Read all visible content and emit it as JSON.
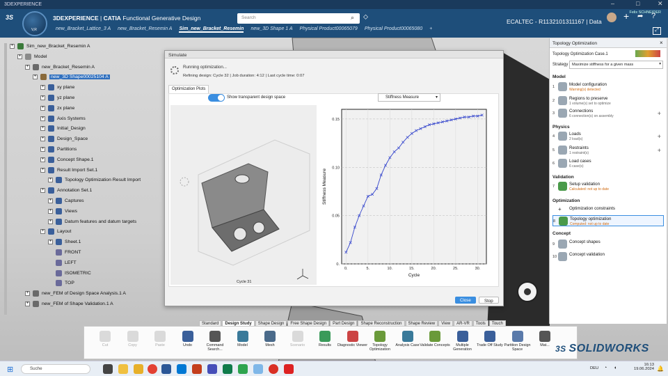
{
  "titlebar": {
    "title": "3DEXPERIENCE"
  },
  "header": {
    "brand_bold": "3DEXPERIENCE",
    "brand_sep": " | ",
    "brand_catia": "CATIA",
    "brand_app": "Functional Generative Design",
    "compass_label": "V,R",
    "search_placeholder": "Search",
    "user_name": "Felix SCHNEIDER",
    "project": "ECALTEC - R1132101311167 | Data",
    "tabs": [
      "new_Bracket_Lattice_3 A",
      "new_Bracket_Resemin A",
      "Sim_new_Bracket_Resemin",
      "new_3D Shape 1 A",
      "Physical Product00065079",
      "Physical Product00065080"
    ],
    "active_tab_index": 2
  },
  "tree": {
    "nodes": [
      {
        "label": "Sim_new_Bracket_Resemin A",
        "depth": 0
      },
      {
        "label": "Model",
        "depth": 1
      },
      {
        "label": "new_Bracket_Resemin A",
        "depth": 2
      },
      {
        "label": "new_3D Shape00025104 A",
        "depth": 3,
        "selected": true
      },
      {
        "label": "xy plane",
        "depth": 4
      },
      {
        "label": "yz plane",
        "depth": 4
      },
      {
        "label": "zx plane",
        "depth": 4
      },
      {
        "label": "Axis Systems",
        "depth": 4
      },
      {
        "label": "Initial_Design",
        "depth": 4
      },
      {
        "label": "Design_Space",
        "depth": 4
      },
      {
        "label": "Partitions",
        "depth": 4
      },
      {
        "label": "Concept Shape.1",
        "depth": 4
      },
      {
        "label": "Result Import Set.1",
        "depth": 4
      },
      {
        "label": "Topology Optimization Result Import",
        "depth": 5
      },
      {
        "label": "Annotation Set.1",
        "depth": 4
      },
      {
        "label": "Captures",
        "depth": 5
      },
      {
        "label": "Views",
        "depth": 5
      },
      {
        "label": "Datum features and datum targets",
        "depth": 5
      },
      {
        "label": "Layout",
        "depth": 4
      },
      {
        "label": "Sheet.1",
        "depth": 5
      },
      {
        "label": "FRONT",
        "depth": 6
      },
      {
        "label": "LEFT",
        "depth": 6
      },
      {
        "label": "ISOMETRIC",
        "depth": 6
      },
      {
        "label": "TOP",
        "depth": 6
      },
      {
        "label": "new_FEM of Design Space Analysis.1 A",
        "depth": 2
      },
      {
        "label": "new_FEM of Shape Validation.1 A",
        "depth": 2
      }
    ]
  },
  "dialog": {
    "title": "Simulate",
    "status": "Running optimization...",
    "details": "Refining design: Cycle 32   |   Job duration: 4:12   |   Last cycle time: 0:07",
    "tab": "Optimization Plots",
    "toggle_label": "Show transparent design space",
    "select_value": "Stiffness Measure",
    "cycle_caption": "Cycle 31",
    "close_label": "Close",
    "stop_label": "Stop"
  },
  "chart_data": {
    "type": "line",
    "xlabel": "Cycle",
    "ylabel": "Stiffness Measure",
    "xlim": [
      -1,
      32
    ],
    "ylim": [
      0,
      0.16
    ],
    "xticks": [
      "0.",
      "5.",
      "10.",
      "15.",
      "20.",
      "25.",
      "30."
    ],
    "yticks": [
      "0.",
      "0.05",
      "0.10",
      "0.15"
    ],
    "series": [
      {
        "x": [
          0,
          1,
          2,
          3,
          4,
          5,
          6,
          7,
          8,
          9,
          10,
          11,
          12,
          13,
          14,
          15,
          16,
          17,
          18,
          19,
          20,
          21,
          22,
          23,
          24,
          25,
          26,
          27,
          28,
          29,
          30,
          31
        ],
        "y": [
          0.012,
          0.022,
          0.038,
          0.05,
          0.06,
          0.07,
          0.072,
          0.078,
          0.092,
          0.102,
          0.11,
          0.116,
          0.12,
          0.126,
          0.131,
          0.135,
          0.138,
          0.14,
          0.142,
          0.144,
          0.145,
          0.146,
          0.147,
          0.148,
          0.149,
          0.15,
          0.151,
          0.152,
          0.152,
          0.153,
          0.153,
          0.154
        ]
      }
    ]
  },
  "rpanel": {
    "title": "Topology Optimization",
    "case": "Topology Optimization Case.1",
    "strategy_label": "Strategy",
    "strategy_value": "Maximize stiffness for a given mass",
    "sections": {
      "model": "Model",
      "physics": "Physics",
      "validation": "Validation",
      "optimization": "Optimization",
      "concept": "Concept"
    },
    "items": [
      {
        "num": "1",
        "label": "Model configuration",
        "sub": "Warning(s) detected"
      },
      {
        "num": "2",
        "label": "Regions to preserve",
        "sub": "1 volume(s) set to optimize"
      },
      {
        "num": "3",
        "label": "Connections",
        "sub": "6 connection(s) on assembly"
      },
      {
        "num": "4",
        "label": "Loads",
        "sub": "2 load(s)"
      },
      {
        "num": "5",
        "label": "Restraints",
        "sub": "1 restraint(s)"
      },
      {
        "num": "6",
        "label": "Load cases",
        "sub": "6 case(s)"
      },
      {
        "num": "7",
        "label": "Setup validation",
        "sub": "Calculated: not up to date"
      },
      {
        "num": "",
        "label": "Optimization constraints",
        "sub": ""
      },
      {
        "num": "8",
        "label": "Topology optimization",
        "sub": "Computed: not up to date"
      },
      {
        "num": "9",
        "label": "Concept shapes",
        "sub": ""
      },
      {
        "num": "10",
        "label": "Concept validation",
        "sub": ""
      }
    ]
  },
  "actionbar": {
    "tabs": [
      "Standard",
      "Design Study",
      "Shape Design",
      "Free Shape Design",
      "Part Design",
      "Shape Reconstruction",
      "Shape Review",
      "View",
      "AR-VR",
      "Tools",
      "Touch"
    ],
    "active_tab_index": 1,
    "actions": [
      {
        "label": "Cut",
        "disabled": true
      },
      {
        "label": "Copy",
        "disabled": true
      },
      {
        "label": "Paste",
        "disabled": true
      },
      {
        "label": "Undo",
        "disabled": false
      },
      {
        "label": "Command Search...",
        "disabled": false
      },
      {
        "label": "Model",
        "disabled": false
      },
      {
        "label": "Mesh",
        "disabled": false
      },
      {
        "label": "Scenario",
        "disabled": true
      },
      {
        "label": "Results",
        "disabled": false
      },
      {
        "label": "Diagnostic Viewer",
        "disabled": false
      },
      {
        "label": "Topology Optimization",
        "disabled": false
      },
      {
        "label": "Analysis Case",
        "disabled": false
      },
      {
        "label": "Validate Concepts",
        "disabled": false
      },
      {
        "label": "Multiple Generation",
        "disabled": false
      },
      {
        "label": "Trade Off Study",
        "disabled": false
      },
      {
        "label": "Partition Design Space",
        "disabled": false
      },
      {
        "label": "Mat...",
        "disabled": false
      }
    ]
  },
  "watermark": "SOLIDWORKS",
  "taskbar": {
    "search": "Suche",
    "lang": "DEU",
    "time": "16:13",
    "date": "19.06.2024"
  }
}
